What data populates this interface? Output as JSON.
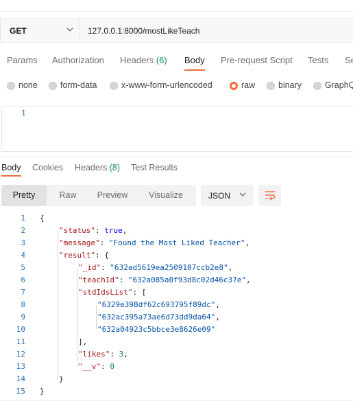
{
  "request": {
    "method": "GET",
    "url": "127.0.0.1:8000/mostLikeTeach",
    "tabs": [
      {
        "label": "Params"
      },
      {
        "label": "Authorization"
      },
      {
        "label": "Headers",
        "count": "(6)"
      },
      {
        "label": "Body",
        "active": true
      },
      {
        "label": "Pre-request Script"
      },
      {
        "label": "Tests"
      },
      {
        "label": "Se"
      }
    ],
    "body_types": [
      {
        "label": "none",
        "selected": false
      },
      {
        "label": "form-data",
        "selected": false
      },
      {
        "label": "x-www-form-urlencoded",
        "selected": false
      },
      {
        "label": "raw",
        "selected": true
      },
      {
        "label": "binary",
        "selected": false
      },
      {
        "label": "GraphQ",
        "selected": false
      }
    ],
    "editor_line": "1"
  },
  "response": {
    "tabs": [
      {
        "label": "Body",
        "active": true
      },
      {
        "label": "Cookies"
      },
      {
        "label": "Headers",
        "count": "(8)"
      },
      {
        "label": "Test Results"
      }
    ],
    "view_modes": [
      "Pretty",
      "Raw",
      "Preview",
      "Visualize"
    ],
    "active_view": "Pretty",
    "format": "JSON",
    "line_numbers": [
      "1",
      "2",
      "3",
      "4",
      "5",
      "6",
      "7",
      "8",
      "9",
      "10",
      "11",
      "12",
      "13",
      "14",
      "15"
    ],
    "json": {
      "status": "true",
      "message": "\"Found the Most Liked Teacher\"",
      "_id": "\"632ad5619ea2509107ccb2e8\"",
      "teachId": "\"632a085a0f93d8c02d46c37e\"",
      "stdIds": [
        "\"6329e398df62c693795f89dc\"",
        "\"632ac395a73ae6d73dd9da64\"",
        "\"632a04923c5bbce3e8626e09\""
      ],
      "likes": "3",
      "__v": "0"
    }
  },
  "colors": {
    "accent": "#f26b3a",
    "count": "#0f8c54",
    "linenum": "#2a6fb0"
  }
}
